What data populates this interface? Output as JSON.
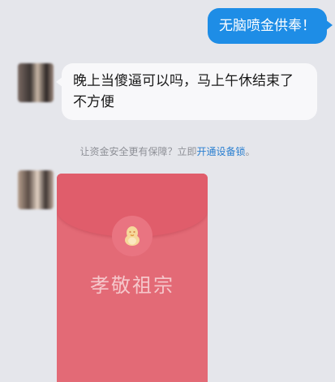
{
  "messages": {
    "outgoing_text": "无脑喷金供奉！",
    "incoming_text": "晚上当傻逼可以吗，马上午休结束了不方便"
  },
  "system_note": {
    "prefix": "让资金安全更有保障？立即",
    "link_text": "开通设备锁",
    "suffix": "。"
  },
  "red_packet": {
    "title": "孝敬祖宗",
    "icon": "penguin-icon"
  },
  "colors": {
    "outgoing_bubble": "#1e8de6",
    "incoming_bubble": "#f8f8fa",
    "red_packet": "#e36a76",
    "link": "#2a7fd0"
  }
}
